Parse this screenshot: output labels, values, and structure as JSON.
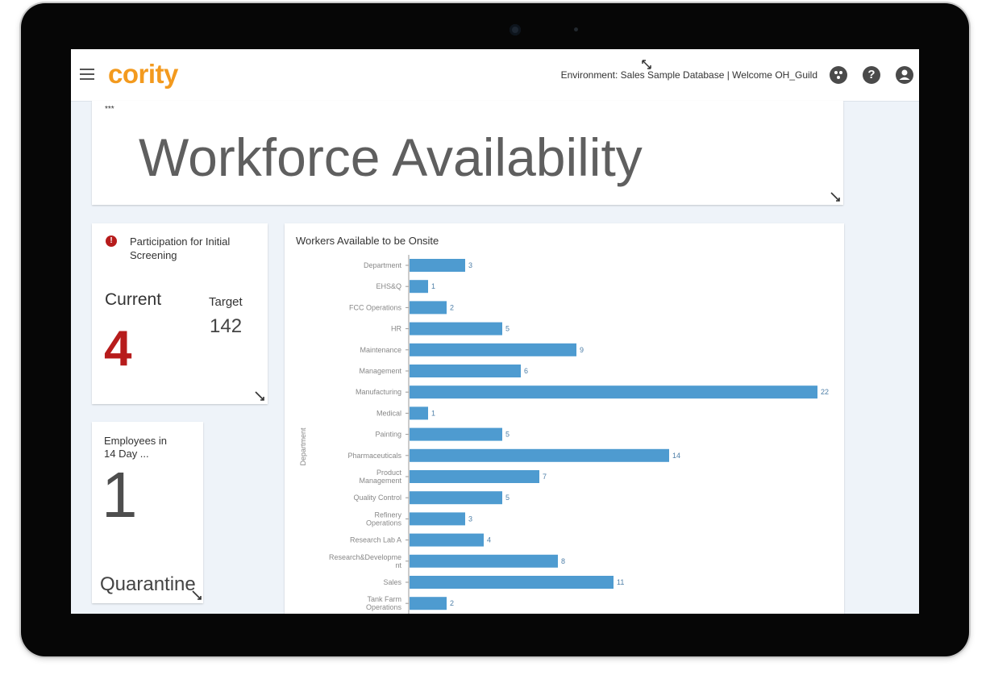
{
  "topbar": {
    "brand": "cority",
    "environment_text": "Environment: Sales Sample Database | Welcome OH_Guild",
    "icons": [
      "apps-icon",
      "help-icon",
      "account-icon"
    ]
  },
  "title_panel": {
    "menu_dots": "***",
    "title": "Workforce Availability"
  },
  "kpi_participation": {
    "title": "Participation for Initial Screening",
    "current_label": "Current",
    "current_value": "4",
    "target_label": "Target",
    "target_value": "142",
    "alert_color": "#b71c1c"
  },
  "kpi_quarantine": {
    "title": "Employees in 14 Day ...",
    "value": "1",
    "label": "Quarantine"
  },
  "chart_data": {
    "type": "bar",
    "orientation": "horizontal",
    "title": "Workers Available to be Onsite",
    "ylabel": "Department",
    "xlabel": "",
    "categories": [
      "Department",
      "EHS&Q",
      "FCC Operations",
      "HR",
      "Maintenance",
      "Management",
      "Manufacturing",
      "Medical",
      "Painting",
      "Pharmaceuticals",
      "Product Management",
      "Quality Control",
      "Refinery Operations",
      "Research Lab A",
      "Research&Development",
      "Sales",
      "Tank Farm Operations"
    ],
    "values": [
      3,
      1,
      2,
      5,
      9,
      6,
      22,
      1,
      5,
      14,
      7,
      5,
      3,
      4,
      8,
      11,
      2
    ],
    "bar_color": "#4e9bd0",
    "grid": false
  }
}
